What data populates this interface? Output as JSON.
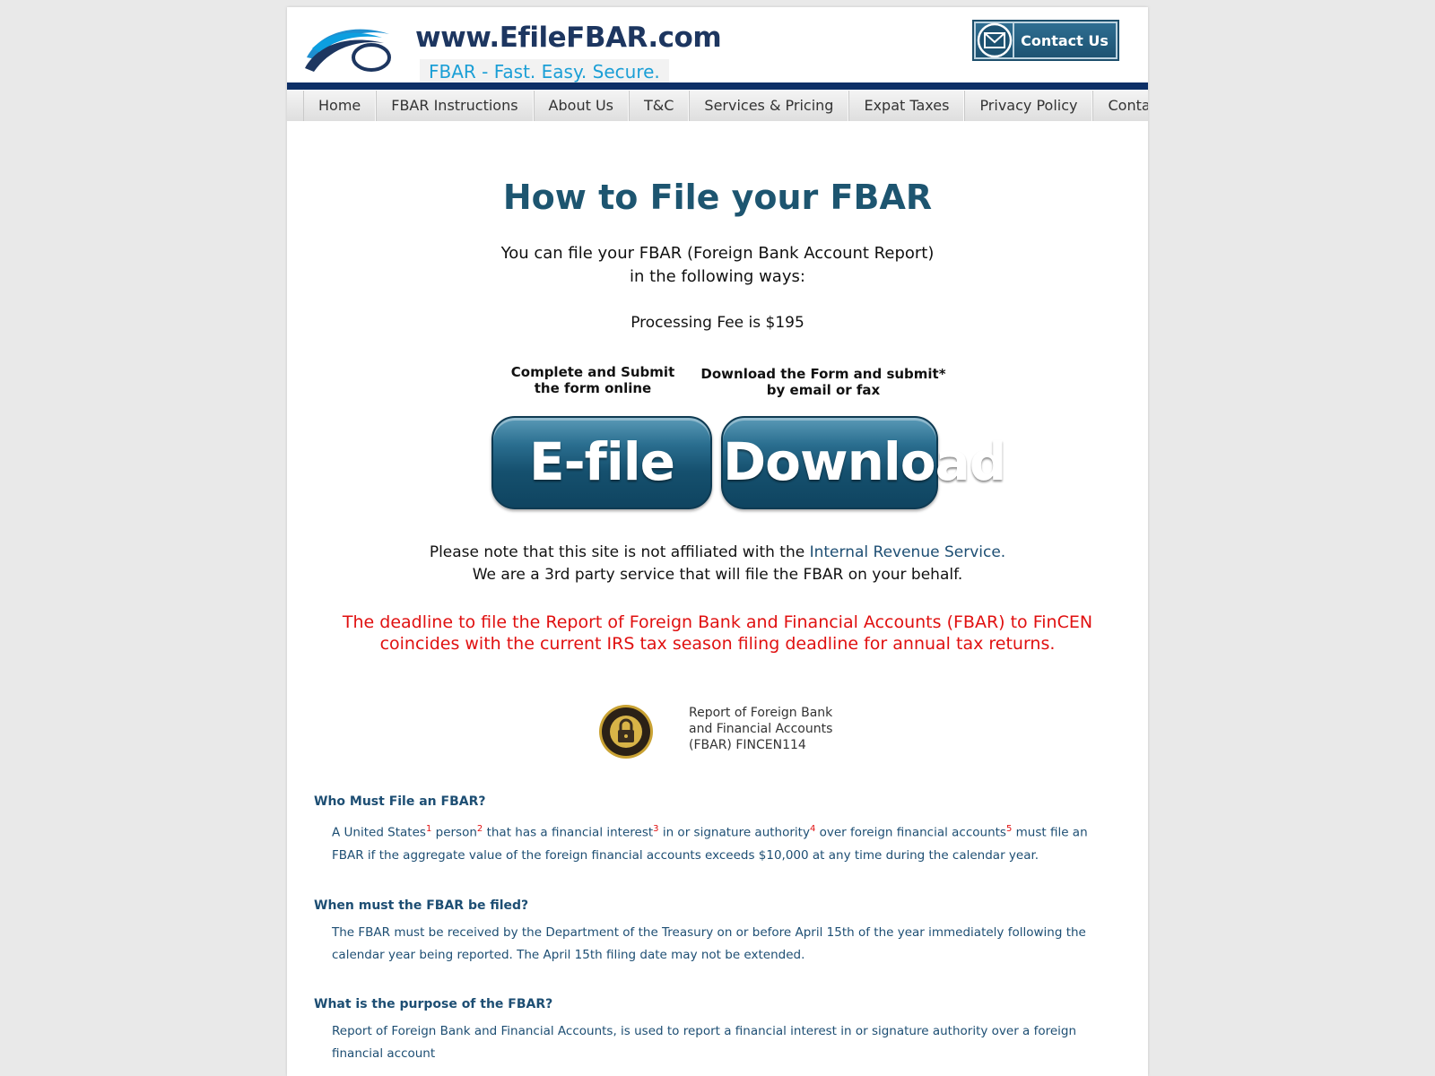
{
  "header": {
    "logo_title": "www.EfileFBAR.com",
    "logo_tagline": "FBAR - Fast. Easy. Secure.",
    "contact_label": "Contact Us"
  },
  "nav": {
    "items": [
      {
        "label": "Home"
      },
      {
        "label": "FBAR Instructions"
      },
      {
        "label": "About Us"
      },
      {
        "label": "T&C"
      },
      {
        "label": "Services & Pricing"
      },
      {
        "label": "Expat Taxes"
      },
      {
        "label": "Privacy Policy"
      },
      {
        "label": "Contact Us"
      }
    ]
  },
  "main": {
    "title": "How to File your FBAR",
    "intro_line1": "You can file your FBAR (Foreign Bank Account Report)",
    "intro_line2": "in the following ways:",
    "fee": "Processing Fee is $195",
    "efile": {
      "caption_line1": "Complete and Submit",
      "caption_line2": "the form online",
      "button": "E-file"
    },
    "download": {
      "caption_line1": "Download the Form and submit*",
      "caption_line2": "by email or fax",
      "button": "Download"
    },
    "note_prefix": "Please note that this site is not affiliated with the ",
    "note_link": "Internal Revenue Service.",
    "note_line2": "We are a 3rd party service that will file the FBAR on your behalf.",
    "deadline_line1": "The deadline to file the Report of Foreign Bank and Financial Accounts (FBAR) to FinCEN",
    "deadline_line2": "coincides with the current IRS tax season filing deadline for annual tax returns.",
    "seal_text_line1": "Report of Foreign Bank",
    "seal_text_line2": "and Financial Accounts",
    "seal_text_line3": "(FBAR) FINCEN114"
  },
  "faq": {
    "q1": "Who Must File an FBAR?",
    "a1": {
      "p1": "A United States",
      "s1": "1",
      "p2": " person",
      "s2": "2",
      "p3": " that has a financial interest",
      "s3": "3",
      "p4": " in or signature authority",
      "s4": "4",
      "p5": " over foreign financial accounts",
      "s5": "5",
      "p6": " must file an FBAR if the aggregate value of the foreign financial accounts exceeds $10,000 at any time during the calendar year."
    },
    "q2": "When must the FBAR be filed?",
    "a2": "The FBAR must be received by the Department of the Treasury on or before April 15th of the year immediately following the calendar year being reported. The April 15th filing date may not be extended.",
    "q3": "What is the purpose of the FBAR?",
    "a3": "Report of Foreign Bank and Financial Accounts, is used to report a financial interest in or signature authority over a foreign financial account"
  },
  "colors": {
    "brand_navy": "#0d2f66",
    "title_teal": "#1d5570",
    "deadline_red": "#e01010",
    "tagline_blue": "#1b9fd6"
  }
}
